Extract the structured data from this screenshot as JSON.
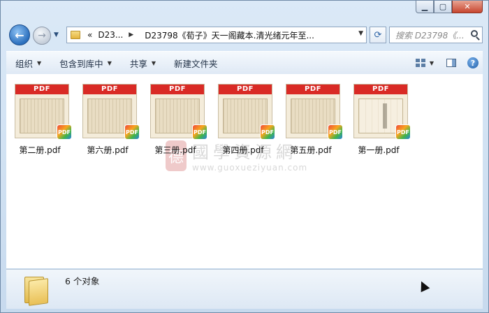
{
  "window": {
    "caption": {
      "minimize": "▁",
      "maximize": "▢",
      "close": "✕"
    }
  },
  "nav": {
    "back_icon": "←",
    "forward_icon": "→",
    "history_icon": "▼",
    "address": {
      "overflow": "«",
      "crumb1": "D23...",
      "crumb2": "D23798《荀子》天一阁藏本.清光绪元年至...",
      "dropdown": "▼"
    },
    "refresh_icon": "⟳",
    "search_placeholder": "搜索 D23798《..."
  },
  "toolbar": {
    "organize": "组织",
    "include_library": "包含到库中",
    "share": "共享",
    "new_folder": "新建文件夹",
    "caret": "▼",
    "help": "?"
  },
  "files": [
    {
      "name": "第二册.pdf",
      "banner": "PDF",
      "badge": "PDF",
      "style": "dense"
    },
    {
      "name": "第六册.pdf",
      "banner": "PDF",
      "badge": "PDF",
      "style": "dense"
    },
    {
      "name": "第三册.pdf",
      "banner": "PDF",
      "badge": "PDF",
      "style": "dense"
    },
    {
      "name": "第四册.pdf",
      "banner": "PDF",
      "badge": "PDF",
      "style": "dense"
    },
    {
      "name": "第五册.pdf",
      "banner": "PDF",
      "badge": "PDF",
      "style": "dense"
    },
    {
      "name": "第一册.pdf",
      "banner": "PDF",
      "badge": "PDF",
      "style": "light"
    }
  ],
  "watermark": {
    "seal": "德",
    "cn": "國學資源網",
    "url": "www.guoxueziyuan.com"
  },
  "status": {
    "count": "6 个对象"
  }
}
